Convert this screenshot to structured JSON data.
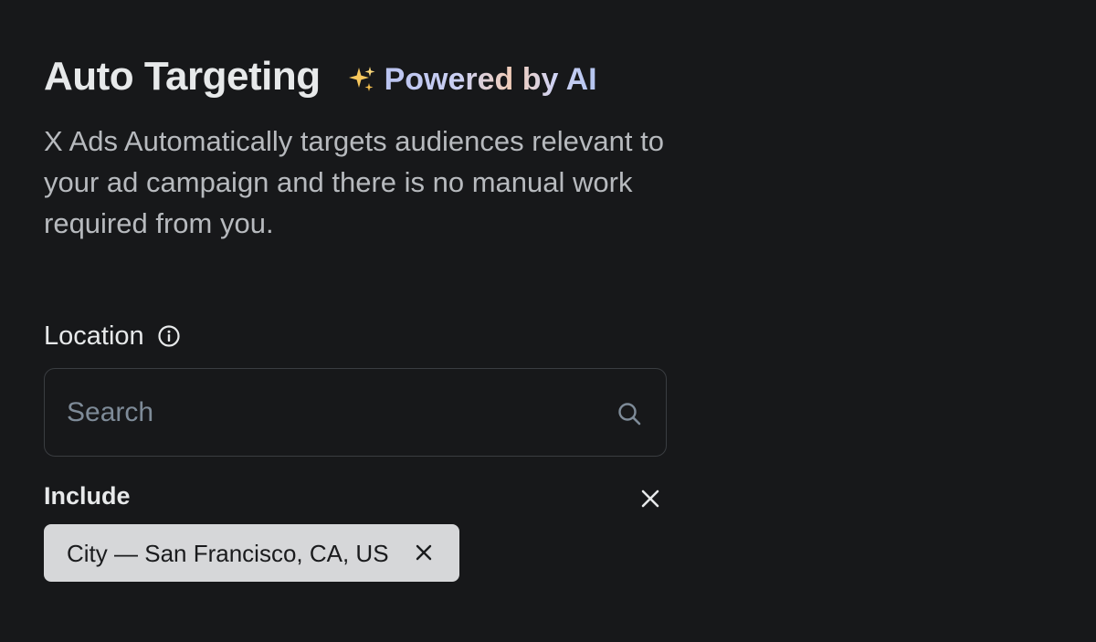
{
  "header": {
    "title": "Auto Targeting",
    "ai_badge": {
      "icon": "sparkle-icon",
      "label": "Powered by AI"
    }
  },
  "description": "X Ads Automatically targets audiences relevant to your ad campaign and there is no manual work required from you.",
  "location": {
    "label": "Location",
    "info_icon": "info-icon",
    "search": {
      "placeholder": "Search",
      "value": "",
      "icon": "search-icon"
    },
    "include": {
      "label": "Include",
      "clear_icon": "close-icon",
      "chips": [
        {
          "label": "City — San Francisco, CA, US",
          "remove_icon": "close-icon"
        }
      ]
    }
  },
  "colors": {
    "background": "#17181a",
    "text_primary": "#e7e9ea",
    "text_secondary": "#b7babe",
    "placeholder": "#7e8b98",
    "border": "#3a3d41",
    "chip_bg": "#d6d7d9",
    "chip_text": "#1a1b1d"
  }
}
